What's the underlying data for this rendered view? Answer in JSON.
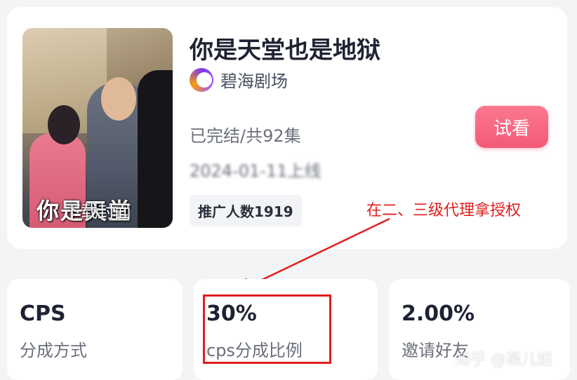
{
  "drama": {
    "cover_title": "你是天堂",
    "cover_download": "下载封面",
    "title": "你是天堂也是地狱",
    "brand": "碧海剧场",
    "status": "已完结/共92集",
    "date_blurred": "2024-01-11上线",
    "promo_count": "推广人数1919",
    "try_button": "试看"
  },
  "annotation": {
    "text": "在二、三级代理拿授权"
  },
  "stats": [
    {
      "value": "CPS",
      "label": "分成方式"
    },
    {
      "value": "30%",
      "label": "cps分成比例"
    },
    {
      "value": "2.00%",
      "label": "邀请好友"
    }
  ],
  "watermark": "知乎 @燕儿姐",
  "colors": {
    "accent": "#f25a77",
    "annotation": "#e01e1e"
  }
}
